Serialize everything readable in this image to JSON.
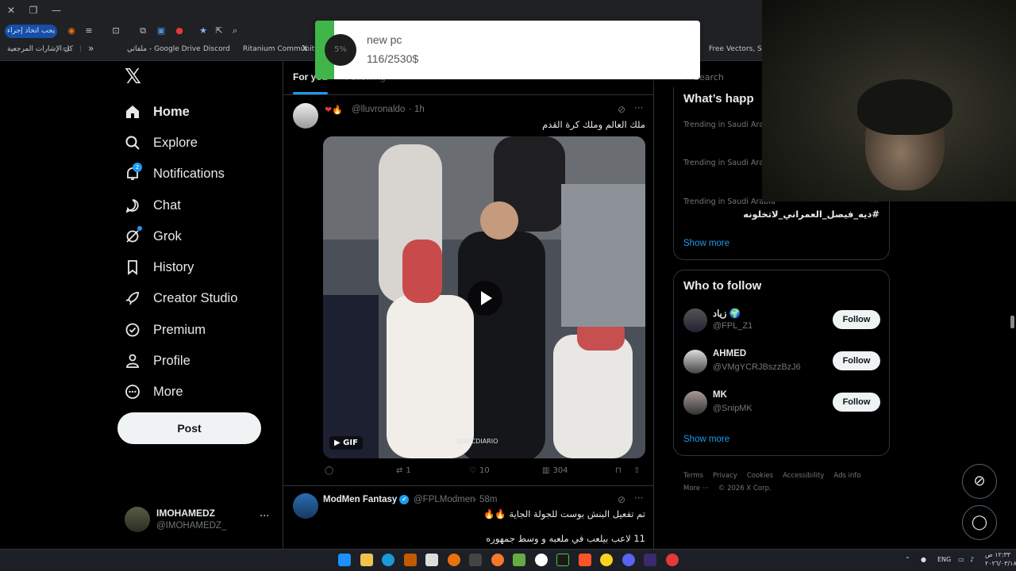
{
  "browser": {
    "action_button": "يجب اتخاذ إجراء",
    "bookmarks": [
      {
        "label": "كل الإشارات المرجعية"
      },
      {
        "label": "ملفاتي - Google Drive"
      },
      {
        "label": "Discord"
      },
      {
        "label": "Ritanium Community"
      },
      {
        "label": "Free Vectors, Stock..."
      }
    ],
    "overflow": "»"
  },
  "nav": {
    "items": [
      {
        "label": "Home",
        "icon": "home-icon"
      },
      {
        "label": "Explore",
        "icon": "search-icon"
      },
      {
        "label": "Notifications",
        "icon": "bell-icon",
        "badge": "2"
      },
      {
        "label": "Chat",
        "icon": "chat-icon"
      },
      {
        "label": "Grok",
        "icon": "grok-icon"
      },
      {
        "label": "History",
        "icon": "bookmark-icon"
      },
      {
        "label": "Creator Studio",
        "icon": "rocket-icon"
      },
      {
        "label": "Premium",
        "icon": "verified-icon"
      },
      {
        "label": "Profile",
        "icon": "person-icon"
      },
      {
        "label": "More",
        "icon": "more-circle-icon"
      }
    ],
    "post": "Post",
    "account": {
      "name": "IMOHAMEDZ",
      "handle": "@IMOHAMEDZ_",
      "more": "···"
    }
  },
  "timeline": {
    "tabs": [
      "For you",
      "Following",
      "",
      "",
      "",
      ""
    ],
    "tweets": [
      {
        "handle": "@lluvronaldo",
        "time": "· 1h",
        "text": "ملك العالم وملك كرة القدم",
        "media_badge": "GIF",
        "media_watermark": "@NFCDIARIO",
        "retweets": "1",
        "likes": "10",
        "views": "304"
      },
      {
        "name": "ModMen Fantasy",
        "handle": "@FPLModmen",
        "time": "· 58m",
        "text": "تم تفعيل البنش بوست للجولة الجاية 🔥🔥",
        "text2": "11 لاعب بيلعب في ملعبه و وسط جمهوره"
      }
    ]
  },
  "right": {
    "search_placeholder": "Search",
    "trends_title": "What’s happ",
    "trends": [
      {
        "meta": "Trending in Saudi Arab"
      },
      {
        "meta": "Trending in Saudi Arab"
      },
      {
        "meta": "Trending in Saudi Arabia",
        "title": "#ديه_فيصل_العمراني_لاتخلونه"
      }
    ],
    "show_more": "Show more",
    "wtf_title": "Who to follow",
    "follow": [
      {
        "name": "زياد 🌍",
        "handle": "@FPL_Z1",
        "button": "Follow"
      },
      {
        "name": "AHMED",
        "handle": "@VMgYCRJBszzBzJ6",
        "button": "Follow"
      },
      {
        "name": "MK",
        "handle": "@SnipMK",
        "button": "Follow"
      }
    ],
    "footer": [
      "Terms",
      "Privacy",
      "Cookies",
      "Accessibility",
      "Ads info",
      "More ···",
      "© 2026 X Corp."
    ]
  },
  "toast": {
    "percent": "5%",
    "title": "new pc",
    "amount": "116/2530$",
    "progress": 0.05
  },
  "taskbar": {
    "lang": "ENG",
    "time": "١٢:٣٣ ص",
    "date": "٢٠٢٦/٠٣/١٨"
  }
}
